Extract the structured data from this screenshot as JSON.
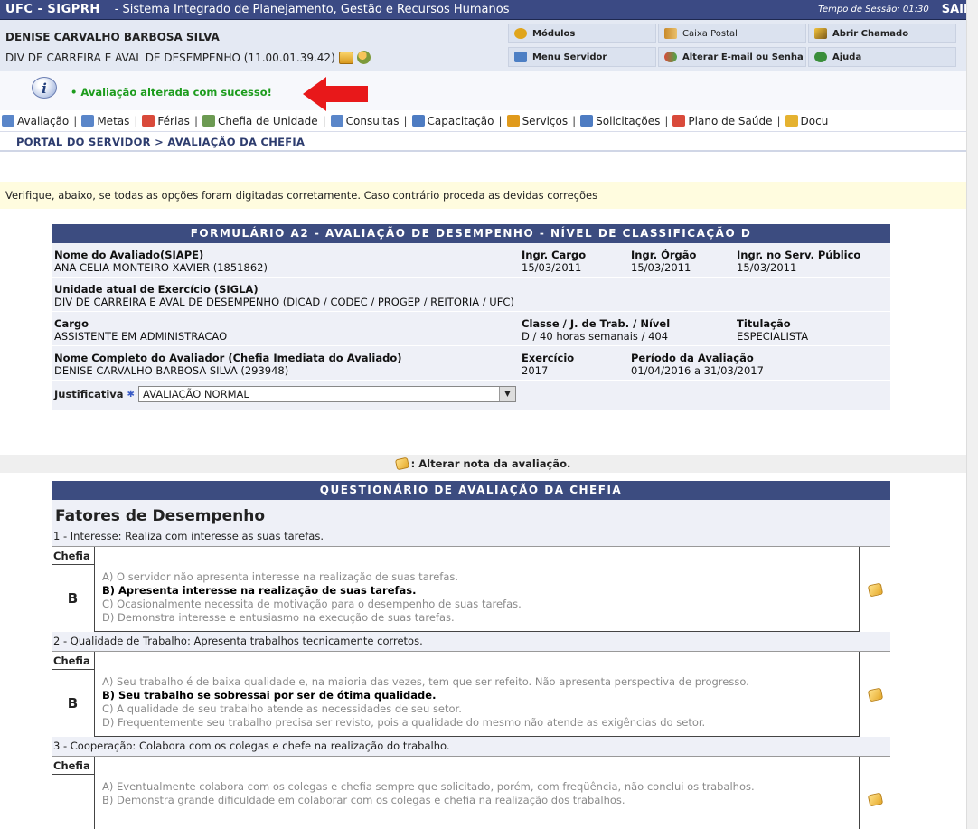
{
  "header": {
    "system_short": "UFC - SIGPRH",
    "system_full": "- Sistema Integrado de Planejamento, Gestão e Recursos Humanos",
    "session_time": "Tempo de Sessão: 01:30",
    "logout": "SAIR"
  },
  "user": {
    "name": "DENISE CARVALHO BARBOSA SILVA",
    "department": "DIV DE CARREIRA E AVAL DE DESEMPENHO (11.00.01.39.42)"
  },
  "menu": {
    "modulos": "Módulos",
    "caixa_postal": "Caixa Postal",
    "abrir_chamado": "Abrir Chamado",
    "menu_servidor": "Menu Servidor",
    "alterar_email": "Alterar E-mail ou Senha",
    "ajuda": "Ajuda"
  },
  "message": {
    "success": "• Avaliação alterada com sucesso!"
  },
  "nav": [
    {
      "label": "Avaliação",
      "icon": "document-edit-icon",
      "color": "#5a86c9"
    },
    {
      "label": "Metas",
      "icon": "target-doc-icon",
      "color": "#5a86c9"
    },
    {
      "label": "Férias",
      "icon": "sun-icon",
      "color": "#d94a3a"
    },
    {
      "label": "Chefia de Unidade",
      "icon": "org-chart-icon",
      "color": "#6c9a52"
    },
    {
      "label": "Consultas",
      "icon": "magnifier-icon",
      "color": "#5a86c9"
    },
    {
      "label": "Capacitação",
      "icon": "book-edit-icon",
      "color": "#4e7cc2"
    },
    {
      "label": "Serviços",
      "icon": "person-icon",
      "color": "#e09a1b"
    },
    {
      "label": "Solicitações",
      "icon": "form-icon",
      "color": "#4e7cc2"
    },
    {
      "label": "Plano de Saúde",
      "icon": "health-cross-icon",
      "color": "#d94a3a"
    },
    {
      "label": "Docu",
      "icon": "folder-icon",
      "color": "#e5b230"
    }
  ],
  "breadcrumb": "PORTAL DO SERVIDOR > AVALIAÇÃO DA CHEFIA",
  "warning": "Verifique, abaixo, se todas as opções foram digitadas corretamente. Caso contrário proceda as devidas correções",
  "form": {
    "caption": "FORMULÁRIO A2 - AVALIAÇÃO DE DESEMPENHO - NÍVEL DE CLASSIFICAÇÃO D",
    "nome_label": "Nome do Avaliado(SIAPE)",
    "nome_value": "ANA CELIA MONTEIRO XAVIER (1851862)",
    "ingr_cargo_label": "Ingr. Cargo",
    "ingr_cargo_value": "15/03/2011",
    "ingr_orgao_label": "Ingr. Órgão",
    "ingr_orgao_value": "15/03/2011",
    "ingr_serv_label": "Ingr. no Serv. Público",
    "ingr_serv_value": "15/03/2011",
    "unidade_label": "Unidade atual de Exercício (SIGLA)",
    "unidade_value": "DIV DE CARREIRA E AVAL DE DESEMPENHO (DICAD / CODEC / PROGEP / REITORIA / UFC)",
    "cargo_label": "Cargo",
    "cargo_value": "ASSISTENTE EM ADMINISTRACAO",
    "classe_label": "Classe / J. de Trab. / Nível",
    "classe_value": "D / 40 horas semanais / 404",
    "titulacao_label": "Titulação",
    "titulacao_value": "ESPECIALISTA",
    "avaliador_label": "Nome Completo do Avaliador (Chefia Imediata do Avaliado)",
    "avaliador_value": "DENISE CARVALHO BARBOSA SILVA (293948)",
    "exercicio_label": "Exercício",
    "exercicio_value": "2017",
    "periodo_label": "Período da Avaliação",
    "periodo_value": "01/04/2016 a 31/03/2017",
    "justificativa_label": "Justificativa",
    "justificativa_value": "AVALIAÇÃO NORMAL"
  },
  "alter_label": ": Alterar nota da avaliação.",
  "questionnaire": {
    "caption": "QUESTIONÁRIO DE AVALIAÇÃO DA CHEFIA",
    "heading": "Fatores de Desempenho",
    "chefia_label": "Chefia",
    "questions": [
      {
        "title": "1 - Interesse: Realiza com interesse as suas tarefas.",
        "grade": "B",
        "options": [
          "A) O servidor não apresenta interesse na realização de suas tarefas.",
          "B) Apresenta interesse na realização de suas tarefas.",
          "C) Ocasionalmente necessita de motivação para o desempenho de suas tarefas.",
          "D) Demonstra interesse e entusiasmo na execução de suas tarefas."
        ]
      },
      {
        "title": "2 - Qualidade de Trabalho: Apresenta trabalhos tecnicamente corretos.",
        "grade": "B",
        "options": [
          "A) Seu trabalho é de baixa qualidade e, na maioria das vezes, tem que ser refeito. Não apresenta perspectiva de progresso.",
          "B) Seu trabalho se sobressai por ser de ótima qualidade.",
          "C) A qualidade de seu trabalho atende as necessidades de seu setor.",
          "D) Frequentemente seu trabalho precisa ser revisto, pois a qualidade do mesmo não atende as exigências do setor."
        ]
      },
      {
        "title": "3 - Cooperação: Colabora com os colegas e chefe na realização do trabalho.",
        "grade": "",
        "options": [
          "A) Eventualmente colabora com os colegas e chefia sempre que solicitado, porém, com freqüência, não conclui os trabalhos.",
          "B) Demonstra grande dificuldade em colaborar com os colegas e chefia na realização dos trabalhos."
        ]
      }
    ]
  }
}
